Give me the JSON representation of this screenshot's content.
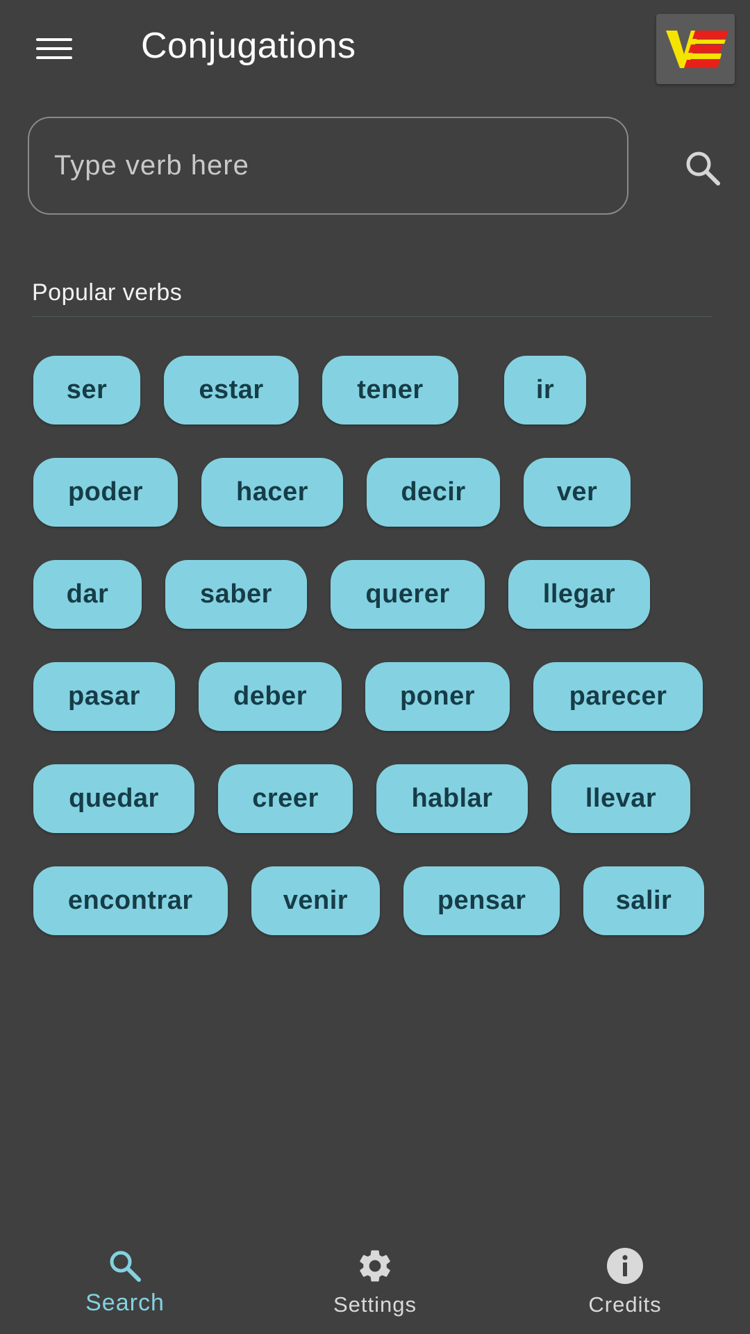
{
  "app_bar": {
    "title": "Conjugations",
    "menu_icon": "hamburger-menu-icon",
    "logo_text": "VE",
    "logo_colors": {
      "v": "#f5e400",
      "stripe": "#e8201a",
      "bg": "#5a5a5a"
    }
  },
  "search": {
    "placeholder": "Type verb here",
    "value": "",
    "icon": "search-icon"
  },
  "popular": {
    "title": "Popular verbs",
    "rows": [
      [
        {
          "label": "ser",
          "w": 154
        },
        {
          "label": "estar",
          "w": 194
        },
        {
          "label": "tener",
          "w": 196
        },
        {
          "label": "ir",
          "w": 118,
          "gap": 66
        }
      ],
      [
        {
          "label": "poder",
          "w": 208
        },
        {
          "label": "hacer",
          "w": 204
        },
        {
          "label": "decir",
          "w": 192
        },
        {
          "label": "ver",
          "w": 154
        }
      ],
      [
        {
          "label": "dar",
          "w": 156
        },
        {
          "label": "saber",
          "w": 204
        },
        {
          "label": "querer",
          "w": 222
        },
        {
          "label": "llegar",
          "w": 204
        }
      ],
      [
        {
          "label": "pasar",
          "w": 204
        },
        {
          "label": "deber",
          "w": 206
        },
        {
          "label": "poner",
          "w": 208
        },
        {
          "label": "parecer",
          "w": 244
        }
      ],
      [
        {
          "label": "quedar",
          "w": 232
        },
        {
          "label": "creer",
          "w": 194
        },
        {
          "label": "hablar",
          "w": 218
        },
        {
          "label": "llevar",
          "w": 200
        }
      ],
      [
        {
          "label": "encontrar",
          "w": 286
        },
        {
          "label": "venir",
          "w": 190
        },
        {
          "label": "pensar",
          "w": 230
        },
        {
          "label": "salir",
          "w": 178
        }
      ]
    ]
  },
  "bottom_nav": [
    {
      "label": "Search",
      "icon": "search-icon",
      "active": true
    },
    {
      "label": "Settings",
      "icon": "gear-icon",
      "active": false
    },
    {
      "label": "Credits",
      "icon": "info-icon",
      "active": false
    }
  ],
  "colors": {
    "background": "#404040",
    "chip_bg": "#84d2e1",
    "chip_text": "#163c47",
    "accent": "#84d2e1"
  }
}
